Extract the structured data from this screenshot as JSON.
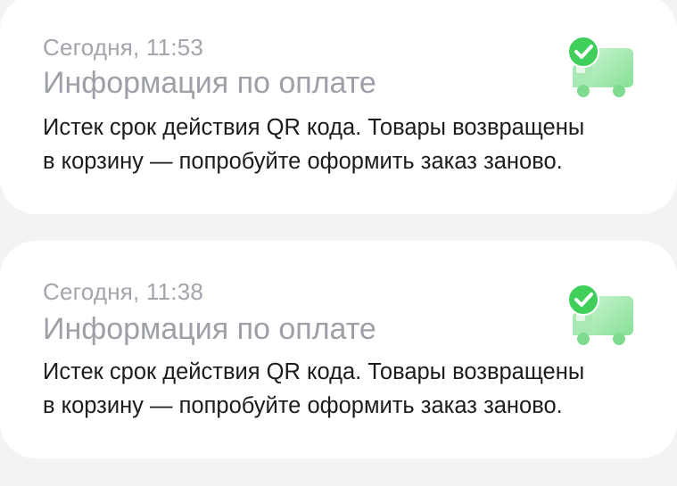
{
  "notifications": [
    {
      "time": "Сегодня, 11:53",
      "title": "Информация по оплате",
      "line1": "Истек срок действия QR кода. Товары возвращены",
      "line2": "в корзину — попробуйте оформить заказ заново.",
      "icon": "delivery-truck-check-icon"
    },
    {
      "time": "Сегодня, 11:38",
      "title": "Информация по оплате",
      "line1": "Истек срок действия QR кода. Товары возвращены",
      "line2": "в корзину — попробуйте оформить заказ заново.",
      "icon": "delivery-truck-check-icon"
    }
  ],
  "colors": {
    "background": "#f2f3f5",
    "card": "#ffffff",
    "accent_green": "#3fcf5a",
    "truck_green": "#8de39a",
    "muted_text": "#a3a5ad",
    "body_text": "#1c1c1e"
  }
}
